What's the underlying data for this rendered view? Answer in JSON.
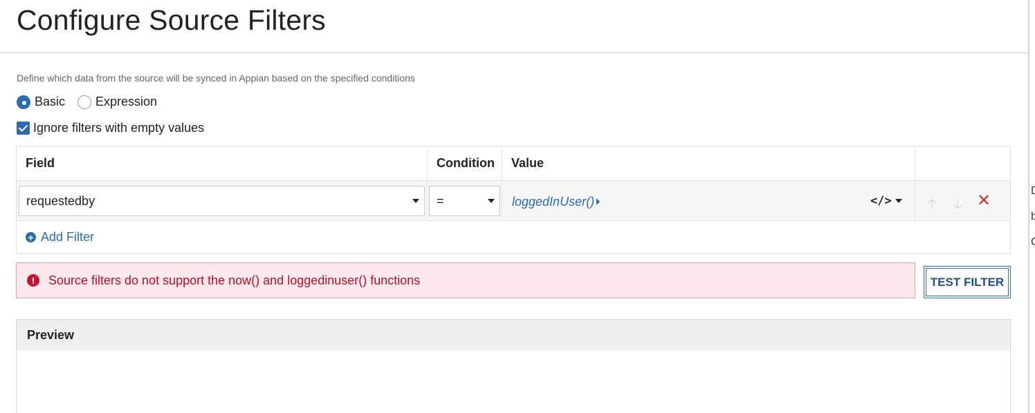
{
  "page": {
    "title": "Configure Source Filters",
    "description": "Define which data from the source will be synced in Appian based on the specified conditions"
  },
  "mode": {
    "options": [
      {
        "label": "Basic",
        "selected": true
      },
      {
        "label": "Expression",
        "selected": false
      }
    ]
  },
  "ignore_empty": {
    "label": "Ignore filters with empty values",
    "checked": true
  },
  "grid": {
    "headers": {
      "field": "Field",
      "condition": "Condition",
      "value": "Value"
    },
    "rows": [
      {
        "field": "requestedby",
        "condition": "=",
        "value": "loggedInUser()"
      }
    ],
    "add_filter_label": "Add Filter",
    "expression_icon": "</>"
  },
  "error": {
    "message": "Source filters do not support the now() and loggedinuser() functions"
  },
  "test_filter": {
    "label": "TEST FILTER"
  },
  "preview": {
    "title": "Preview"
  },
  "icons": {
    "radio": "radio-icon",
    "checkbox": "checkbox-icon",
    "move_up": "arrow-up-icon",
    "move_down": "arrow-down-icon",
    "remove": "close-icon",
    "add": "plus-circle-icon",
    "error": "exclamation-circle-icon"
  },
  "colors": {
    "accent": "#2c6ab1",
    "error_text": "#b4102e",
    "error_bg": "#fde9ec",
    "remove": "#d0312d"
  },
  "right_peek": [
    "D",
    "b",
    "C"
  ]
}
